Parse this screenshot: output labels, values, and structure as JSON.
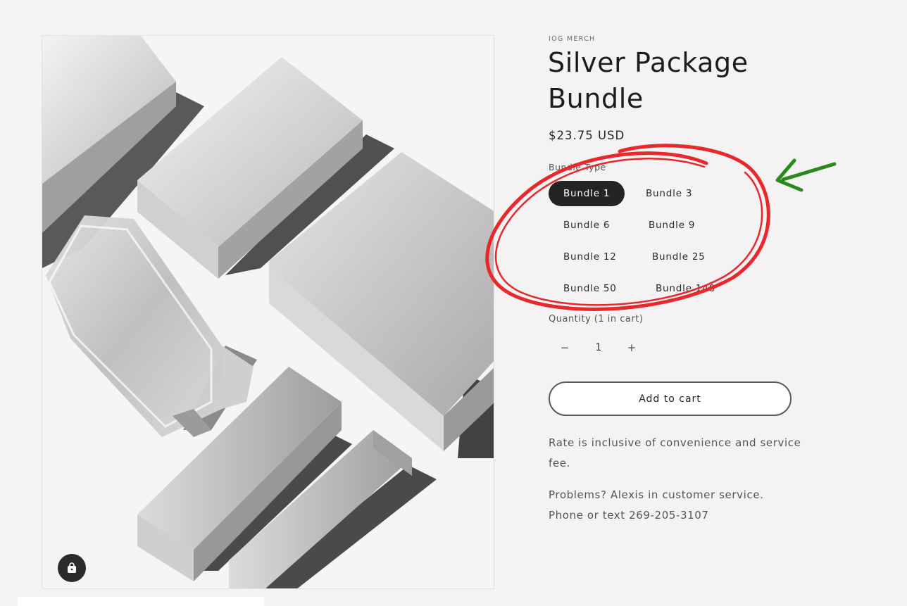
{
  "product": {
    "vendor": "IOG MERCH",
    "title": "Silver Package Bundle",
    "price": "$23.75 USD"
  },
  "variants": {
    "label": "Bundle Type",
    "selected": "Bundle 1",
    "options": [
      "Bundle 1",
      "Bundle 3",
      "Bundle 6",
      "Bundle 9",
      "Bundle 12",
      "Bundle 25",
      "Bundle 50",
      "Bundle 140"
    ]
  },
  "quantity": {
    "label": "Quantity (1 in cart)",
    "value": "1",
    "minus": "−",
    "plus": "+"
  },
  "cart": {
    "add_label": "Add to cart"
  },
  "description": {
    "line1": "Rate is inclusive of convenience and service fee.",
    "line2": "Problems? Alexis in customer service. Phone or text 269-205-3107"
  },
  "icons": {
    "bag": "shopping-bag-icon",
    "image": "product-image-silver-boxes"
  },
  "colors": {
    "background": "#f4f2f3",
    "selected_pill": "#242424",
    "annotation_circle": "#e8282b",
    "annotation_arrow": "#2a8a1e"
  }
}
